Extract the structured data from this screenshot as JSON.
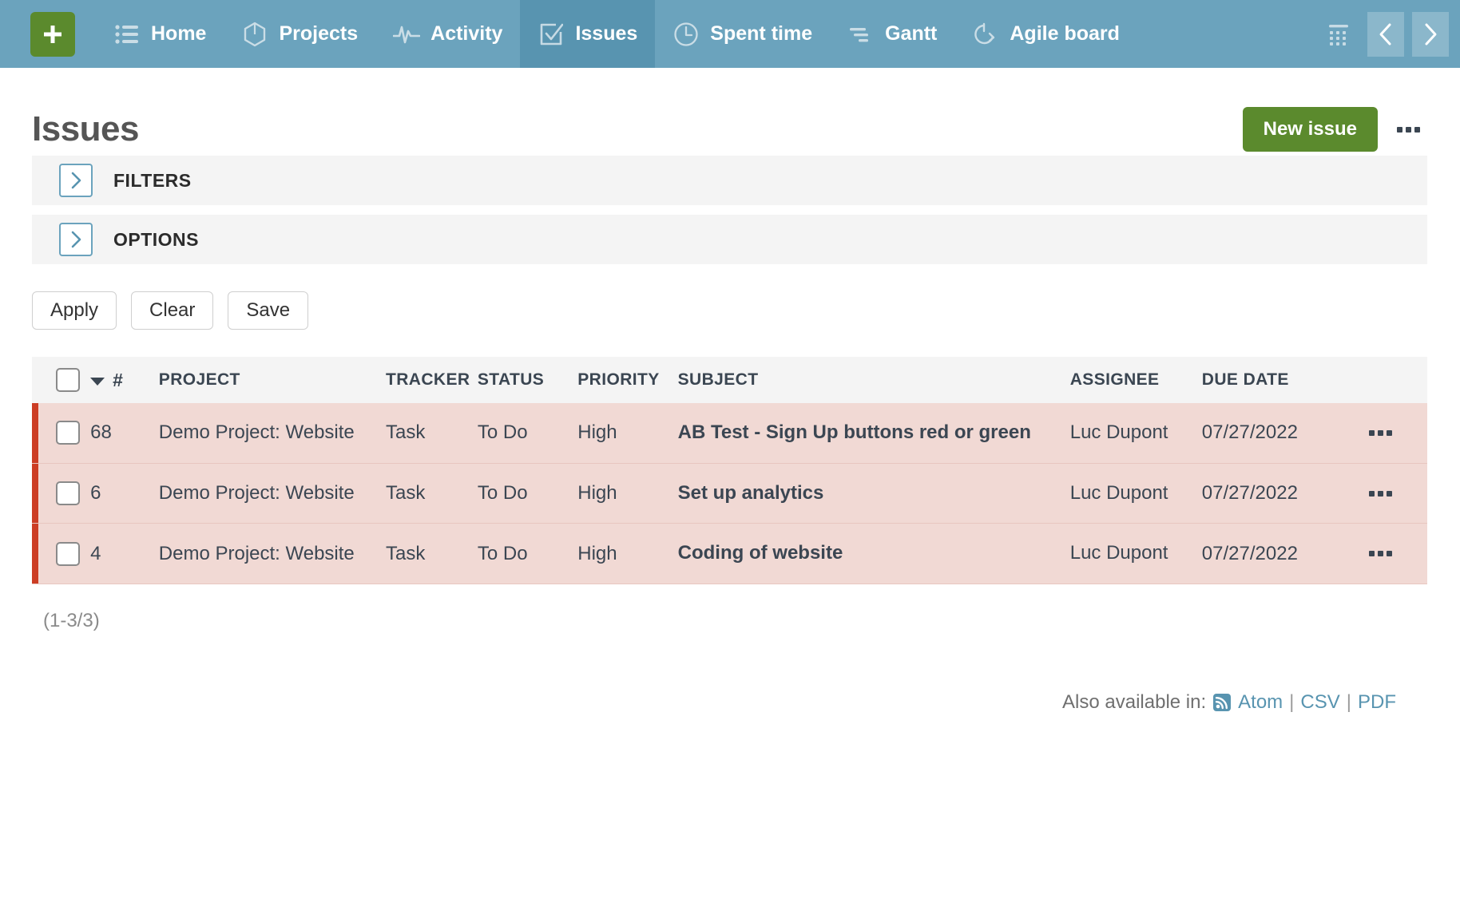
{
  "nav": {
    "add_label": "+",
    "items": [
      {
        "label": "Home",
        "icon": "list-icon",
        "active": false
      },
      {
        "label": "Projects",
        "icon": "cube-icon",
        "active": false
      },
      {
        "label": "Activity",
        "icon": "pulse-icon",
        "active": false
      },
      {
        "label": "Issues",
        "icon": "checkbox-icon",
        "active": true
      },
      {
        "label": "Spent time",
        "icon": "clock-icon",
        "active": false
      },
      {
        "label": "Gantt",
        "icon": "gantt-icon",
        "active": false
      },
      {
        "label": "Agile board",
        "icon": "agile-icon",
        "active": false
      }
    ],
    "grid_icon": "grid-icon",
    "prev_icon": "chevron-left-icon",
    "next_icon": "chevron-right-icon",
    "colors": {
      "bar": "#6ba3bd",
      "active_tab": "#5894b0",
      "add_button": "#5b8a2d"
    }
  },
  "header": {
    "title": "Issues",
    "new_issue_label": "New issue",
    "more_icon": "ellipsis-icon"
  },
  "panels": [
    {
      "label": "FILTERS",
      "toggle_icon": "chevron-right-icon",
      "expanded": false
    },
    {
      "label": "OPTIONS",
      "toggle_icon": "chevron-right-icon",
      "expanded": false
    }
  ],
  "filter_actions": [
    {
      "label": "Apply"
    },
    {
      "label": "Clear"
    },
    {
      "label": "Save"
    }
  ],
  "table": {
    "columns": [
      "#",
      "PROJECT",
      "TRACKER",
      "STATUS",
      "PRIORITY",
      "SUBJECT",
      "ASSIGNEE",
      "DUE DATE"
    ],
    "sort_icon": "sort-descending-caret",
    "select_all_icon": "checkbox-unchecked",
    "rows": [
      {
        "id": "68",
        "project": "Demo Project: Website",
        "tracker": "Task",
        "status": "To Do",
        "priority": "High",
        "subject": "AB Test - Sign Up buttons red or green",
        "assignee": "Luc Dupont",
        "due_date": "07/27/2022",
        "menu_icon": "ellipsis-icon",
        "checkbox_icon": "checkbox-unchecked"
      },
      {
        "id": "6",
        "project": "Demo Project: Website",
        "tracker": "Task",
        "status": "To Do",
        "priority": "High",
        "subject": "Set up analytics",
        "assignee": "Luc Dupont",
        "due_date": "07/27/2022",
        "menu_icon": "ellipsis-icon",
        "checkbox_icon": "checkbox-unchecked"
      },
      {
        "id": "4",
        "project": "Demo Project: Website",
        "tracker": "Task",
        "status": "To Do",
        "priority": "High",
        "subject": "Coding of website",
        "assignee": "Luc Dupont",
        "due_date": "07/27/2022",
        "menu_icon": "ellipsis-icon",
        "checkbox_icon": "checkbox-unchecked"
      }
    ],
    "colors": {
      "row_background": "#f1d9d4",
      "row_flag": "#cc3d24",
      "priority_high": "#d9421c",
      "header_background": "#f4f4f4"
    }
  },
  "footer": {
    "pagination": "(1-3/3)",
    "also_available_label": "Also available in:",
    "rss_icon": "rss-icon",
    "formats": [
      "Atom",
      "CSV",
      "PDF"
    ],
    "separator": "|"
  }
}
